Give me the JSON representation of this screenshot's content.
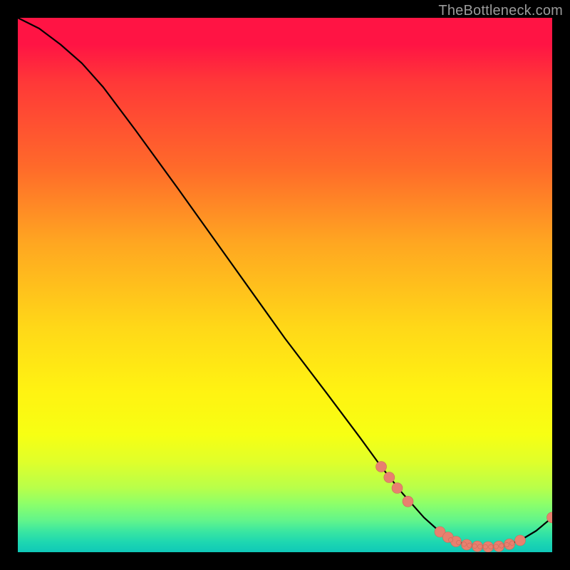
{
  "watermark": "TheBottleneck.com",
  "colors": {
    "background": "#000000",
    "curve": "#000000",
    "marker_fill": "#e8806f",
    "marker_stroke": "#c86a5a"
  },
  "chart_data": {
    "type": "line",
    "title": "",
    "xlabel": "",
    "ylabel": "",
    "xlim": [
      0,
      100
    ],
    "ylim": [
      0,
      100
    ],
    "grid": false,
    "curve": [
      {
        "x": 0,
        "y": 100
      },
      {
        "x": 4,
        "y": 98
      },
      {
        "x": 8,
        "y": 95
      },
      {
        "x": 12,
        "y": 91.5
      },
      {
        "x": 16,
        "y": 87
      },
      {
        "x": 22,
        "y": 79
      },
      {
        "x": 30,
        "y": 68
      },
      {
        "x": 40,
        "y": 54
      },
      {
        "x": 50,
        "y": 40
      },
      {
        "x": 58,
        "y": 29.5
      },
      {
        "x": 64,
        "y": 21.5
      },
      {
        "x": 68,
        "y": 16
      },
      {
        "x": 72,
        "y": 11
      },
      {
        "x": 76,
        "y": 6.5
      },
      {
        "x": 79,
        "y": 3.8
      },
      {
        "x": 82,
        "y": 2
      },
      {
        "x": 85,
        "y": 1.2
      },
      {
        "x": 88,
        "y": 1
      },
      {
        "x": 91,
        "y": 1.2
      },
      {
        "x": 94,
        "y": 2.2
      },
      {
        "x": 97,
        "y": 4
      },
      {
        "x": 100,
        "y": 6.5
      }
    ],
    "markers_large": [
      {
        "x": 68,
        "y": 16
      },
      {
        "x": 69.5,
        "y": 14
      },
      {
        "x": 71,
        "y": 12
      },
      {
        "x": 73,
        "y": 9.5
      },
      {
        "x": 79,
        "y": 3.8
      },
      {
        "x": 80.5,
        "y": 2.8
      },
      {
        "x": 82,
        "y": 2
      },
      {
        "x": 84,
        "y": 1.4
      },
      {
        "x": 86,
        "y": 1.1
      },
      {
        "x": 88,
        "y": 1
      },
      {
        "x": 90,
        "y": 1.1
      },
      {
        "x": 92,
        "y": 1.5
      },
      {
        "x": 94,
        "y": 2.2
      },
      {
        "x": 100,
        "y": 6.5
      }
    ],
    "markers_small": [
      {
        "x": 81,
        "y": 2.3
      },
      {
        "x": 82.5,
        "y": 1.8
      },
      {
        "x": 83.5,
        "y": 1.5
      },
      {
        "x": 84.5,
        "y": 1.3
      },
      {
        "x": 85.5,
        "y": 1.15
      },
      {
        "x": 86.5,
        "y": 1.05
      },
      {
        "x": 87.5,
        "y": 1.0
      },
      {
        "x": 88.5,
        "y": 1.0
      },
      {
        "x": 89.5,
        "y": 1.05
      },
      {
        "x": 90.5,
        "y": 1.2
      },
      {
        "x": 91.5,
        "y": 1.4
      },
      {
        "x": 92.5,
        "y": 1.7
      }
    ]
  }
}
